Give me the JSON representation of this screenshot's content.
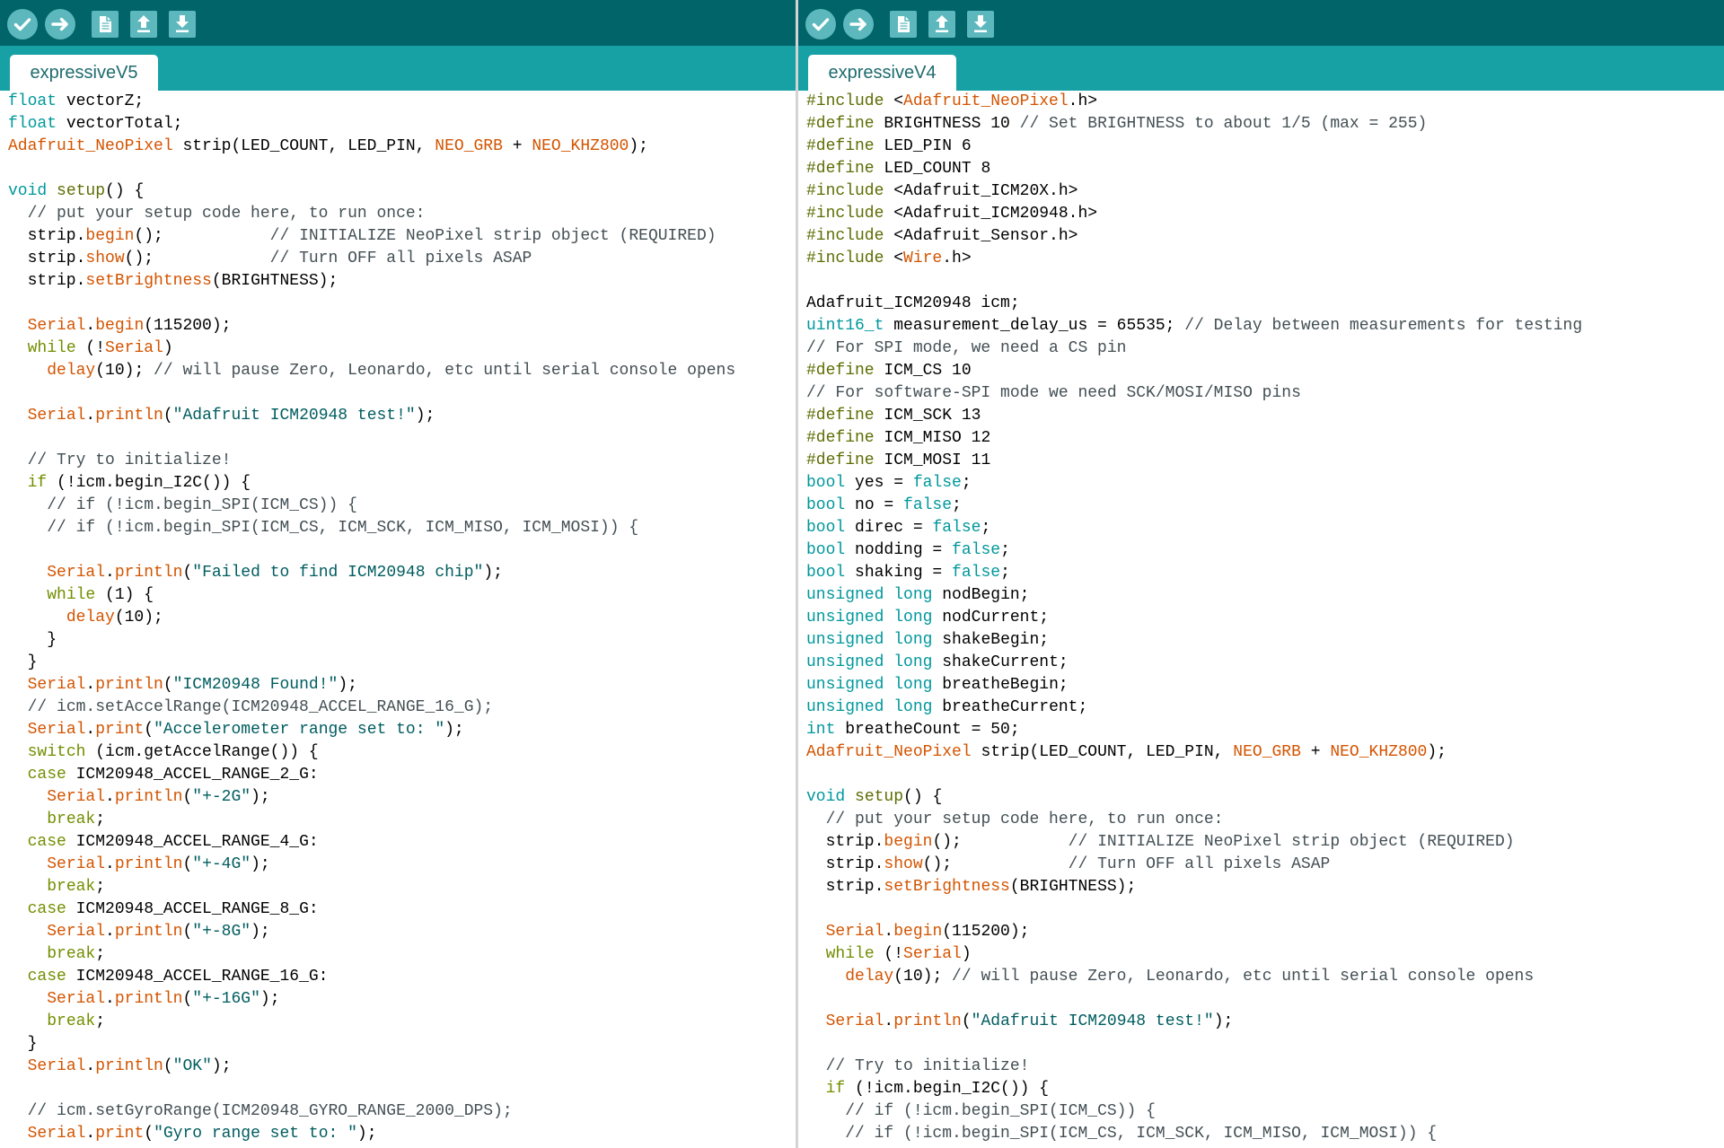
{
  "colors": {
    "toolbar_bg": "#006468",
    "tabbar_bg": "#17A1A5",
    "tab_bg": "#FFFFFF",
    "tab_text": "#1E6B6E",
    "editor_bg": "#FFFFFF",
    "button_fill": "#5CB8BC",
    "button_glyph": "#FFFFFF",
    "divider": "#D4D4D4"
  },
  "syntax_colors": {
    "plain": "#000000",
    "type": "#00979C",
    "fn": "#D35400",
    "ctrl": "#728E00",
    "pre": "#5E6D03",
    "cmt": "#434F54",
    "str": "#005C5F"
  },
  "toolbar_icons": [
    "check-circle-icon",
    "arrow-right-circle-icon",
    "new-file-icon",
    "open-up-arrow-icon",
    "save-down-arrow-icon"
  ],
  "windows": [
    {
      "tab_label": "expressiveV5",
      "lines": [
        [
          [
            "type",
            "float"
          ],
          " vectorZ;"
        ],
        [
          [
            "type",
            "float"
          ],
          " vectorTotal;"
        ],
        [
          [
            "fn",
            "Adafruit_NeoPixel"
          ],
          " strip(LED_COUNT, LED_PIN, ",
          [
            "fn",
            "NEO_GRB"
          ],
          " + ",
          [
            "fn",
            "NEO_KHZ800"
          ],
          ");"
        ],
        [],
        [
          [
            "type",
            "void"
          ],
          " ",
          [
            "pre",
            "setup"
          ],
          "() {"
        ],
        [
          "  ",
          [
            "cmt",
            "// put your setup code here, to run once:"
          ]
        ],
        [
          "  strip.",
          [
            "fn",
            "begin"
          ],
          "();           ",
          [
            "cmt",
            "// INITIALIZE NeoPixel strip object (REQUIRED)"
          ]
        ],
        [
          "  strip.",
          [
            "fn",
            "show"
          ],
          "();            ",
          [
            "cmt",
            "// Turn OFF all pixels ASAP"
          ]
        ],
        [
          "  strip.",
          [
            "fn",
            "setBrightness"
          ],
          "(BRIGHTNESS);"
        ],
        [],
        [
          "  ",
          [
            "fn",
            "Serial"
          ],
          ".",
          [
            "fn",
            "begin"
          ],
          "(115200);"
        ],
        [
          "  ",
          [
            "ctrl",
            "while"
          ],
          " (!",
          [
            "fn",
            "Serial"
          ],
          ")"
        ],
        [
          "    ",
          [
            "fn",
            "delay"
          ],
          "(10); ",
          [
            "cmt",
            "// will pause Zero, Leonardo, etc until serial console opens"
          ]
        ],
        [],
        [
          "  ",
          [
            "fn",
            "Serial"
          ],
          ".",
          [
            "fn",
            "println"
          ],
          "(",
          [
            "str",
            "\"Adafruit ICM20948 test!\""
          ],
          ");"
        ],
        [],
        [
          "  ",
          [
            "cmt",
            "// Try to initialize!"
          ]
        ],
        [
          "  ",
          [
            "ctrl",
            "if"
          ],
          " (!icm.begin_I2C()) {"
        ],
        [
          "    ",
          [
            "cmt",
            "// if (!icm.begin_SPI(ICM_CS)) {"
          ]
        ],
        [
          "    ",
          [
            "cmt",
            "// if (!icm.begin_SPI(ICM_CS, ICM_SCK, ICM_MISO, ICM_MOSI)) {"
          ]
        ],
        [],
        [
          "    ",
          [
            "fn",
            "Serial"
          ],
          ".",
          [
            "fn",
            "println"
          ],
          "(",
          [
            "str",
            "\"Failed to find ICM20948 chip\""
          ],
          ");"
        ],
        [
          "    ",
          [
            "ctrl",
            "while"
          ],
          " (1) {"
        ],
        [
          "      ",
          [
            "fn",
            "delay"
          ],
          "(10);"
        ],
        [
          "    }"
        ],
        [
          "  }"
        ],
        [
          "  ",
          [
            "fn",
            "Serial"
          ],
          ".",
          [
            "fn",
            "println"
          ],
          "(",
          [
            "str",
            "\"ICM20948 Found!\""
          ],
          ");"
        ],
        [
          "  ",
          [
            "cmt",
            "// icm.setAccelRange(ICM20948_ACCEL_RANGE_16_G);"
          ]
        ],
        [
          "  ",
          [
            "fn",
            "Serial"
          ],
          ".",
          [
            "fn",
            "print"
          ],
          "(",
          [
            "str",
            "\"Accelerometer range set to: \""
          ],
          ");"
        ],
        [
          "  ",
          [
            "ctrl",
            "switch"
          ],
          " (icm.getAccelRange()) {"
        ],
        [
          "  ",
          [
            "ctrl",
            "case"
          ],
          " ICM20948_ACCEL_RANGE_2_G:"
        ],
        [
          "    ",
          [
            "fn",
            "Serial"
          ],
          ".",
          [
            "fn",
            "println"
          ],
          "(",
          [
            "str",
            "\"+-2G\""
          ],
          ");"
        ],
        [
          "    ",
          [
            "ctrl",
            "break"
          ],
          ";"
        ],
        [
          "  ",
          [
            "ctrl",
            "case"
          ],
          " ICM20948_ACCEL_RANGE_4_G:"
        ],
        [
          "    ",
          [
            "fn",
            "Serial"
          ],
          ".",
          [
            "fn",
            "println"
          ],
          "(",
          [
            "str",
            "\"+-4G\""
          ],
          ");"
        ],
        [
          "    ",
          [
            "ctrl",
            "break"
          ],
          ";"
        ],
        [
          "  ",
          [
            "ctrl",
            "case"
          ],
          " ICM20948_ACCEL_RANGE_8_G:"
        ],
        [
          "    ",
          [
            "fn",
            "Serial"
          ],
          ".",
          [
            "fn",
            "println"
          ],
          "(",
          [
            "str",
            "\"+-8G\""
          ],
          ");"
        ],
        [
          "    ",
          [
            "ctrl",
            "break"
          ],
          ";"
        ],
        [
          "  ",
          [
            "ctrl",
            "case"
          ],
          " ICM20948_ACCEL_RANGE_16_G:"
        ],
        [
          "    ",
          [
            "fn",
            "Serial"
          ],
          ".",
          [
            "fn",
            "println"
          ],
          "(",
          [
            "str",
            "\"+-16G\""
          ],
          ");"
        ],
        [
          "    ",
          [
            "ctrl",
            "break"
          ],
          ";"
        ],
        [
          "  }"
        ],
        [
          "  ",
          [
            "fn",
            "Serial"
          ],
          ".",
          [
            "fn",
            "println"
          ],
          "(",
          [
            "str",
            "\"OK\""
          ],
          ");"
        ],
        [],
        [
          "  ",
          [
            "cmt",
            "// icm.setGyroRange(ICM20948_GYRO_RANGE_2000_DPS);"
          ]
        ],
        [
          "  ",
          [
            "fn",
            "Serial"
          ],
          ".",
          [
            "fn",
            "print"
          ],
          "(",
          [
            "str",
            "\"Gyro range set to: \""
          ],
          ");"
        ]
      ]
    },
    {
      "tab_label": "expressiveV4",
      "lines": [
        [
          [
            "pre",
            "#include"
          ],
          " <",
          [
            "fn",
            "Adafruit_NeoPixel"
          ],
          ".h>"
        ],
        [
          [
            "pre",
            "#define"
          ],
          " BRIGHTNESS 10 ",
          [
            "cmt",
            "// Set BRIGHTNESS to about 1/5 (max = 255)"
          ]
        ],
        [
          [
            "pre",
            "#define"
          ],
          " LED_PIN 6"
        ],
        [
          [
            "pre",
            "#define"
          ],
          " LED_COUNT 8"
        ],
        [
          [
            "pre",
            "#include"
          ],
          " <Adafruit_ICM20X.h>"
        ],
        [
          [
            "pre",
            "#include"
          ],
          " <Adafruit_ICM20948.h>"
        ],
        [
          [
            "pre",
            "#include"
          ],
          " <Adafruit_Sensor.h>"
        ],
        [
          [
            "pre",
            "#include"
          ],
          " <",
          [
            "fn",
            "Wire"
          ],
          ".h>"
        ],
        [],
        [
          "Adafruit_ICM20948 icm;"
        ],
        [
          [
            "type",
            "uint16_t"
          ],
          " measurement_delay_us = 65535; ",
          [
            "cmt",
            "// Delay between measurements for testing"
          ]
        ],
        [
          [
            "cmt",
            "// For SPI mode, we need a CS pin"
          ]
        ],
        [
          [
            "pre",
            "#define"
          ],
          " ICM_CS 10"
        ],
        [
          [
            "cmt",
            "// For software-SPI mode we need SCK/MOSI/MISO pins"
          ]
        ],
        [
          [
            "pre",
            "#define"
          ],
          " ICM_SCK 13"
        ],
        [
          [
            "pre",
            "#define"
          ],
          " ICM_MISO 12"
        ],
        [
          [
            "pre",
            "#define"
          ],
          " ICM_MOSI 11"
        ],
        [
          [
            "type",
            "bool"
          ],
          " yes = ",
          [
            "type",
            "false"
          ],
          ";"
        ],
        [
          [
            "type",
            "bool"
          ],
          " no = ",
          [
            "type",
            "false"
          ],
          ";"
        ],
        [
          [
            "type",
            "bool"
          ],
          " direc = ",
          [
            "type",
            "false"
          ],
          ";"
        ],
        [
          [
            "type",
            "bool"
          ],
          " nodding = ",
          [
            "type",
            "false"
          ],
          ";"
        ],
        [
          [
            "type",
            "bool"
          ],
          " shaking = ",
          [
            "type",
            "false"
          ],
          ";"
        ],
        [
          [
            "type",
            "unsigned"
          ],
          " ",
          [
            "type",
            "long"
          ],
          " nodBegin;"
        ],
        [
          [
            "type",
            "unsigned"
          ],
          " ",
          [
            "type",
            "long"
          ],
          " nodCurrent;"
        ],
        [
          [
            "type",
            "unsigned"
          ],
          " ",
          [
            "type",
            "long"
          ],
          " shakeBegin;"
        ],
        [
          [
            "type",
            "unsigned"
          ],
          " ",
          [
            "type",
            "long"
          ],
          " shakeCurrent;"
        ],
        [
          [
            "type",
            "unsigned"
          ],
          " ",
          [
            "type",
            "long"
          ],
          " breatheBegin;"
        ],
        [
          [
            "type",
            "unsigned"
          ],
          " ",
          [
            "type",
            "long"
          ],
          " breatheCurrent;"
        ],
        [
          [
            "type",
            "int"
          ],
          " breatheCount = 50;"
        ],
        [
          [
            "fn",
            "Adafruit_NeoPixel"
          ],
          " strip(LED_COUNT, LED_PIN, ",
          [
            "fn",
            "NEO_GRB"
          ],
          " + ",
          [
            "fn",
            "NEO_KHZ800"
          ],
          ");"
        ],
        [],
        [
          [
            "type",
            "void"
          ],
          " ",
          [
            "pre",
            "setup"
          ],
          "() {"
        ],
        [
          "  ",
          [
            "cmt",
            "// put your setup code here, to run once:"
          ]
        ],
        [
          "  strip.",
          [
            "fn",
            "begin"
          ],
          "();           ",
          [
            "cmt",
            "// INITIALIZE NeoPixel strip object (REQUIRED)"
          ]
        ],
        [
          "  strip.",
          [
            "fn",
            "show"
          ],
          "();            ",
          [
            "cmt",
            "// Turn OFF all pixels ASAP"
          ]
        ],
        [
          "  strip.",
          [
            "fn",
            "setBrightness"
          ],
          "(BRIGHTNESS);"
        ],
        [],
        [
          "  ",
          [
            "fn",
            "Serial"
          ],
          ".",
          [
            "fn",
            "begin"
          ],
          "(115200);"
        ],
        [
          "  ",
          [
            "ctrl",
            "while"
          ],
          " (!",
          [
            "fn",
            "Serial"
          ],
          ")"
        ],
        [
          "    ",
          [
            "fn",
            "delay"
          ],
          "(10); ",
          [
            "cmt",
            "// will pause Zero, Leonardo, etc until serial console opens"
          ]
        ],
        [],
        [
          "  ",
          [
            "fn",
            "Serial"
          ],
          ".",
          [
            "fn",
            "println"
          ],
          "(",
          [
            "str",
            "\"Adafruit ICM20948 test!\""
          ],
          ");"
        ],
        [],
        [
          "  ",
          [
            "cmt",
            "// Try to initialize!"
          ]
        ],
        [
          "  ",
          [
            "ctrl",
            "if"
          ],
          " (!icm.begin_I2C()) {"
        ],
        [
          "    ",
          [
            "cmt",
            "// if (!icm.begin_SPI(ICM_CS)) {"
          ]
        ],
        [
          "    ",
          [
            "cmt",
            "// if (!icm.begin_SPI(ICM_CS, ICM_SCK, ICM_MISO, ICM_MOSI)) {"
          ]
        ]
      ]
    }
  ]
}
